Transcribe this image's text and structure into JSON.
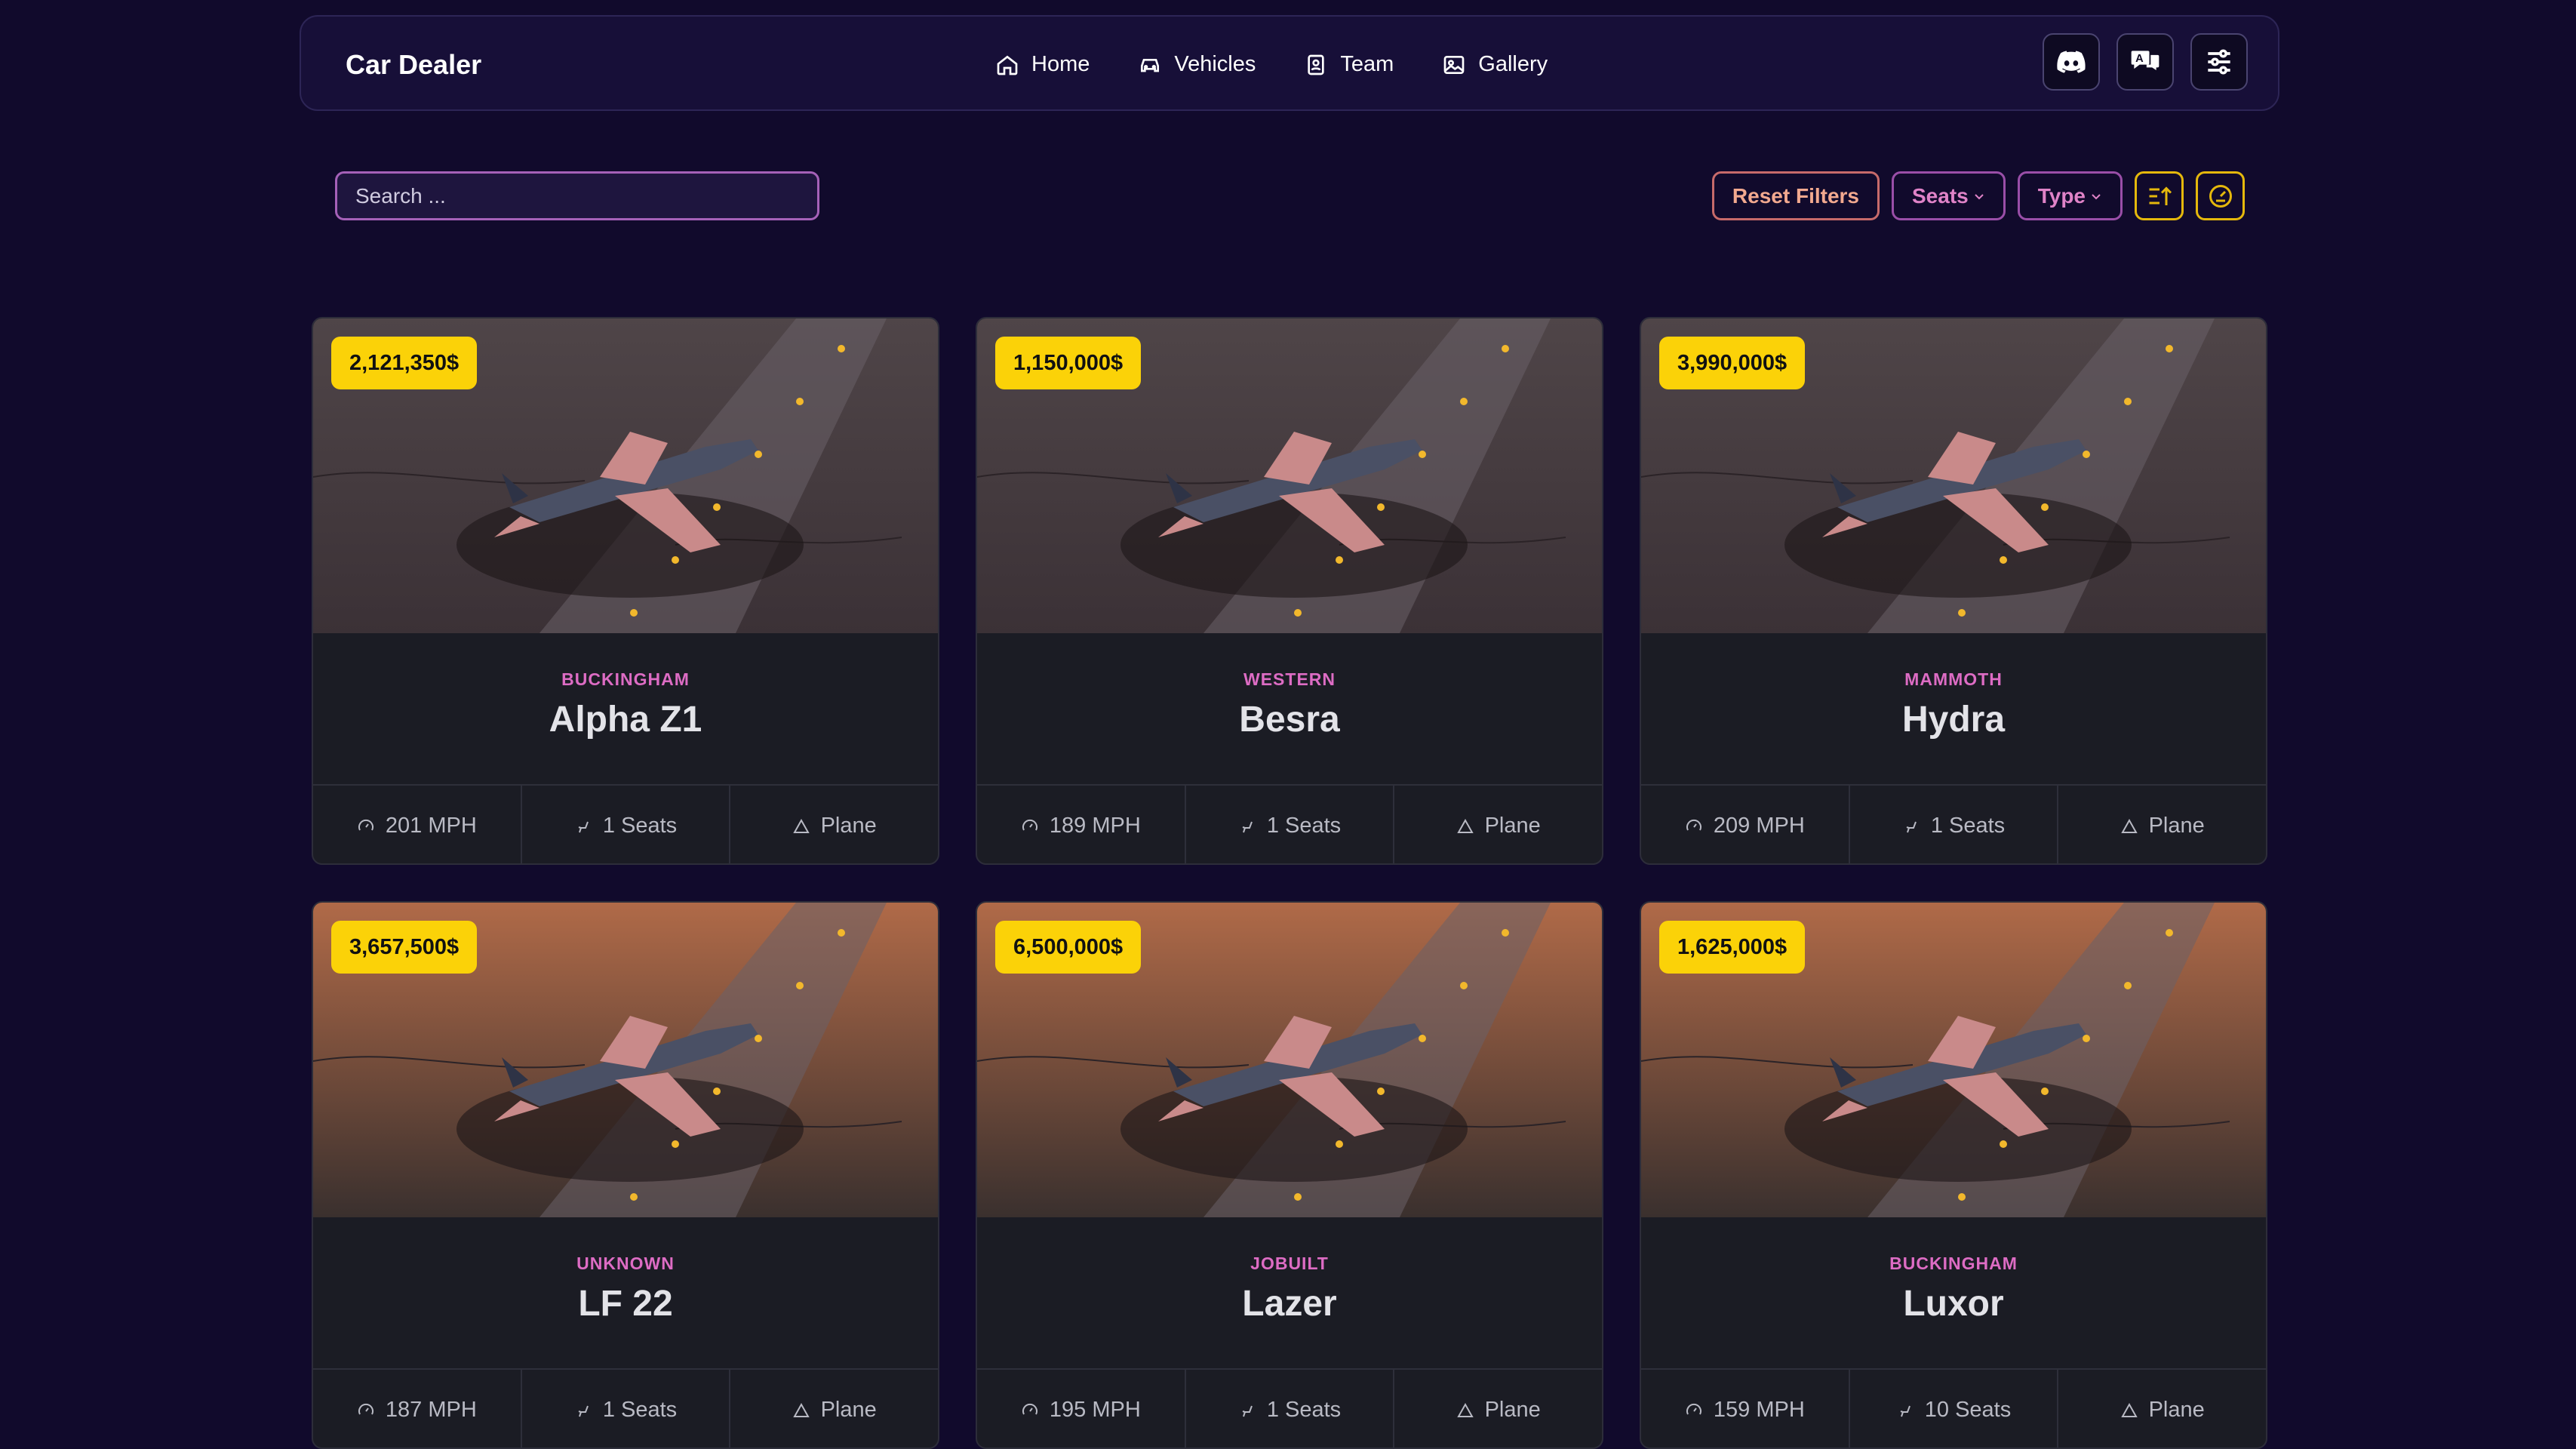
{
  "header": {
    "title": "Car Dealer",
    "nav": [
      {
        "label": "Home",
        "icon": "home-icon"
      },
      {
        "label": "Vehicles",
        "icon": "car-icon"
      },
      {
        "label": "Team",
        "icon": "contacts-icon"
      },
      {
        "label": "Gallery",
        "icon": "image-icon"
      }
    ],
    "actions": [
      "discord-icon",
      "translate-icon",
      "settings-sliders-icon"
    ]
  },
  "toolbar": {
    "search_placeholder": "Search ...",
    "reset_label": "Reset Filters",
    "seats_label": "Seats",
    "type_label": "Type",
    "sort_icon": "sort-ascending-icon",
    "speed_icon": "gauge-icon"
  },
  "colors": {
    "background": "#110a2c",
    "price_badge": "#fbd208",
    "brand_text": "#dd6cc4",
    "accent": "#9a4ea8"
  },
  "vehicles": [
    {
      "price": "2,121,350$",
      "brand": "BUCKINGHAM",
      "model": "Alpha Z1",
      "speed": "201 MPH",
      "seats": "1 Seats",
      "type": "Plane"
    },
    {
      "price": "1,150,000$",
      "brand": "WESTERN",
      "model": "Besra",
      "speed": "189 MPH",
      "seats": "1 Seats",
      "type": "Plane"
    },
    {
      "price": "3,990,000$",
      "brand": "MAMMOTH",
      "model": "Hydra",
      "speed": "209 MPH",
      "seats": "1 Seats",
      "type": "Plane"
    },
    {
      "price": "3,657,500$",
      "brand": "UNKNOWN",
      "model": "LF 22",
      "speed": "187 MPH",
      "seats": "1 Seats",
      "type": "Plane"
    },
    {
      "price": "6,500,000$",
      "brand": "JOBUILT",
      "model": "Lazer",
      "speed": "195 MPH",
      "seats": "1 Seats",
      "type": "Plane"
    },
    {
      "price": "1,625,000$",
      "brand": "BUCKINGHAM",
      "model": "Luxor",
      "speed": "159 MPH",
      "seats": "10 Seats",
      "type": "Plane"
    }
  ]
}
